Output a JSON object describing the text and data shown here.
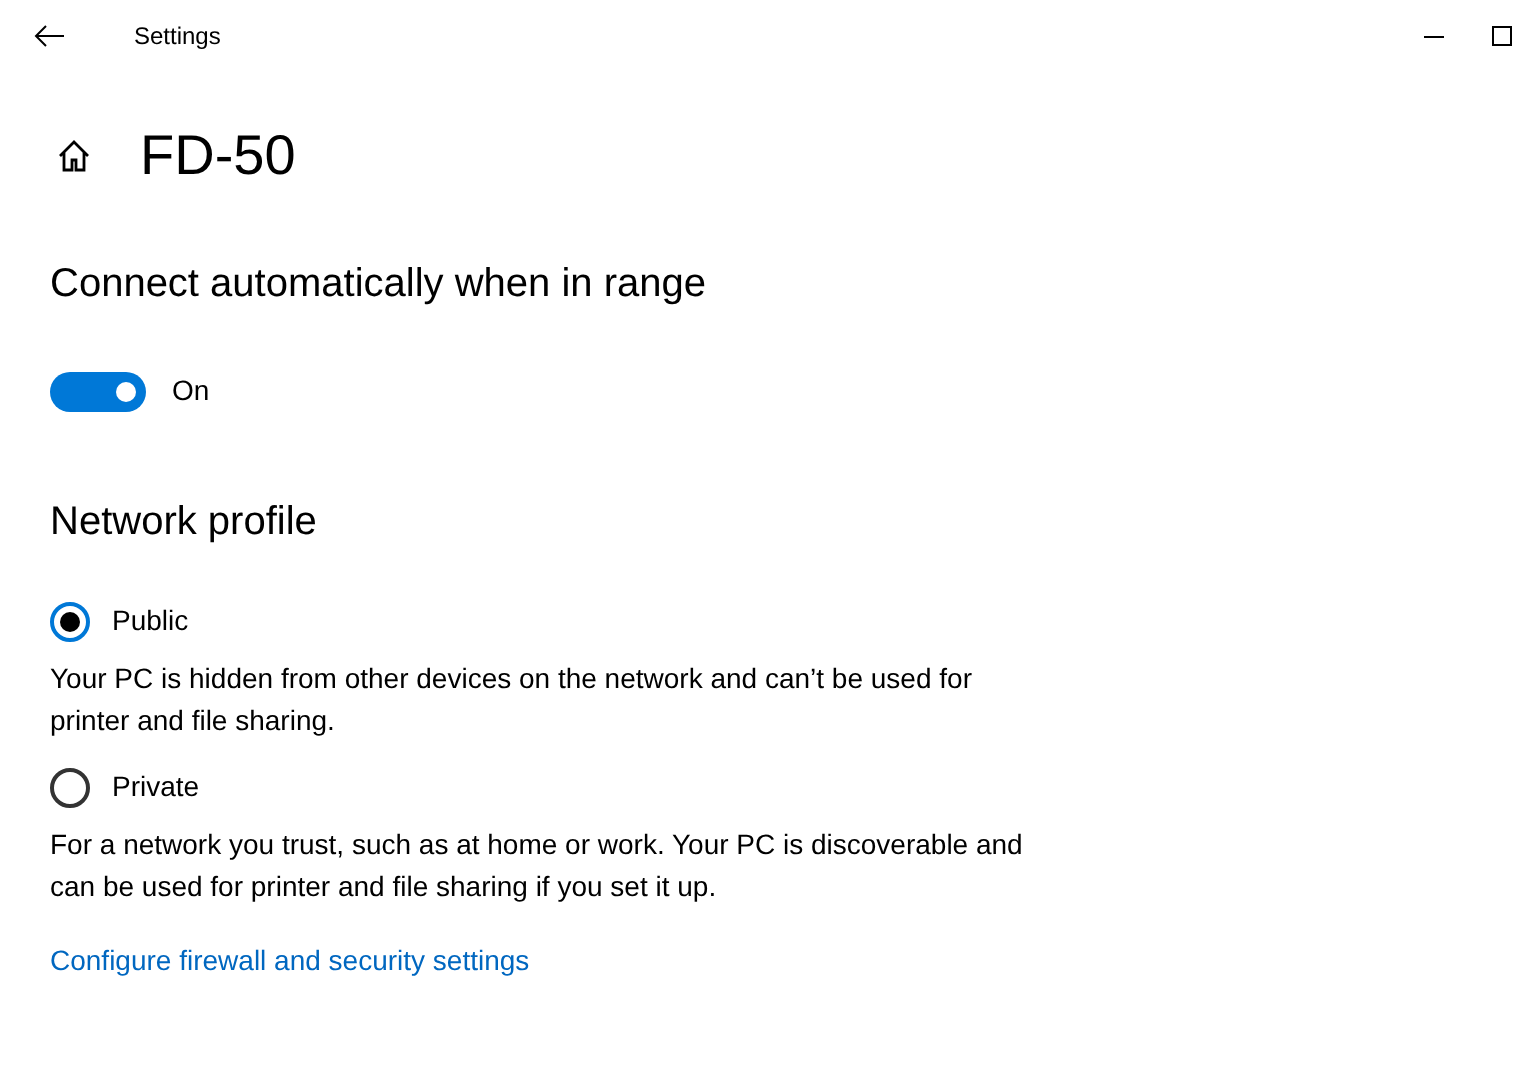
{
  "window": {
    "title": "Settings"
  },
  "page": {
    "title": "FD-50"
  },
  "auto_connect": {
    "heading": "Connect automatically when in range",
    "on": true,
    "state_label": "On"
  },
  "network_profile": {
    "heading": "Network profile",
    "options": [
      {
        "label": "Public",
        "selected": true,
        "description": "Your PC is hidden from other devices on the network and can’t be used for printer and file sharing."
      },
      {
        "label": "Private",
        "selected": false,
        "description": "For a network you trust, such as at home or work. Your PC is discoverable and can be used for printer and file sharing if you set it up."
      }
    ],
    "link": "Configure firewall and security settings"
  }
}
